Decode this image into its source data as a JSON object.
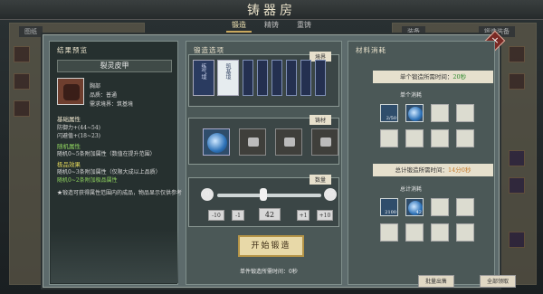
{
  "header": {
    "title": "铸器房",
    "tabs": [
      "锻造",
      "精铸",
      "重铸"
    ]
  },
  "bg_left": {
    "tag": "图纸"
  },
  "bg_right": {
    "tag": "装备",
    "filter": "锻造装备"
  },
  "preview": {
    "title": "结果预览",
    "item_name": "裂灵皮甲",
    "item_type": "胸部",
    "item_quality": "品质：普通",
    "req_label": "需求境界：筑基境",
    "base_head": "基础属性",
    "base_lines": [
      "防御力+(44~54)",
      "闪避值+(18~23)"
    ],
    "rand_head": "随机属性",
    "rand_line": "随机0~5条附加属性（数值在提升范围）",
    "extra_head": "极品效果",
    "extra_lines": [
      "随机0~3条附加属性（仅限大成以上品质）",
      "随机0~2条附加极品属性"
    ],
    "note": "★锻造可获得属性范围内的成品，物品显示仅供参考"
  },
  "forge": {
    "title": "锻造选项",
    "realm_tag": "境界",
    "realm_label": "筑基境",
    "realm_prev": "练气境",
    "material_tag": "铸材",
    "quantity_tag": "数量",
    "quantity_min": "0",
    "quantity_max": "95",
    "quantity": "42",
    "quantity_fill": 0.44,
    "btn_minus10": "-10",
    "btn_minus1": "-1",
    "btn_plus1": "+1",
    "btn_plus10": "+10",
    "start_button": "开始锻造",
    "bottom_label": "单件锻造所需时间：0秒"
  },
  "materials": {
    "title": "材料消耗",
    "time_single": "单个锻造所需时间：",
    "time_single_value": "20秒",
    "single_sub": "单个消耗",
    "slot_count_1": "2/50",
    "time_total": "总计锻造所需时间：",
    "time_total_value": "14分0秒",
    "total_sub": "总计消耗",
    "slot_count_2a": "2100",
    "slot_count_2b": "42"
  },
  "footer": {
    "btn_left": "批量出售",
    "btn_right": "全部领取"
  }
}
